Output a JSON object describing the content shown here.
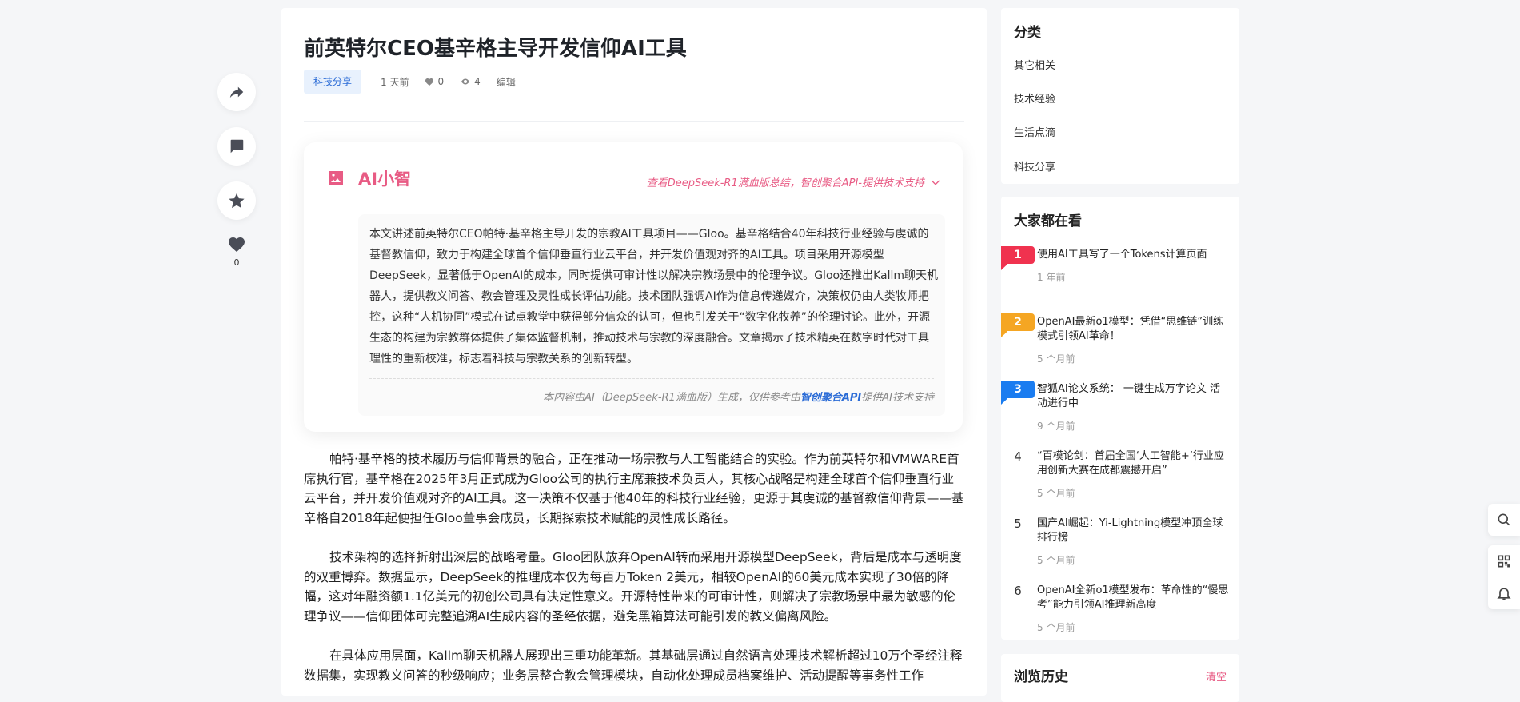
{
  "article": {
    "title": "前英特尔CEO基辛格主导开发信仰AI工具",
    "category_tag": "科技分享",
    "time_ago": "1 天前",
    "likes": "0",
    "views": "4",
    "edit_label": "编辑"
  },
  "actions": {
    "like_count": "0"
  },
  "ai_summary": {
    "name": "AI小智",
    "link_text": "查看DeepSeek-R1满血版总结，智创聚合API-提供技术支持",
    "text": "本文讲述前英特尔CEO帕特·基辛格主导开发的宗教AI工具项目——Gloo。基辛格结合40年科技行业经验与虔诚的基督教信仰，致力于构建全球首个信仰垂直行业云平台，并开发价值观对齐的AI工具。项目采用开源模型DeepSeek，显著低于OpenAI的成本，同时提供可审计性以解决宗教场景中的伦理争议。Gloo还推出Kallm聊天机器人，提供教义问答、教会管理及灵性成长评估功能。技术团队强调AI作为信息传递媒介，决策权仍由人类牧师把控，这种“人机协同”模式在试点教堂中获得部分信众的认可，但也引发关于“数字化牧养”的伦理讨论。此外，开源生态的构建为宗教群体提供了集体监督机制，推动技术与宗教的深度融合。文章揭示了技术精英在数字时代对工具理性的重新校准，标志着科技与宗教关系的创新转型。",
    "footer_prefix": "本内容由AI（DeepSeek-R1满血版）生成，仅供参考由",
    "footer_link": "智创聚合API",
    "footer_suffix": "提供AI技术支持"
  },
  "paragraphs": [
    "帕特·基辛格的技术履历与信仰背景的融合，正在推动一场宗教与人工智能结合的实验。作为前英特尔和VMWARE首席执行官，基辛格在2025年3月正式成为Gloo公司的执行主席兼技术负责人，其核心战略是构建全球首个信仰垂直行业云平台，并开发价值观对齐的AI工具。这一决策不仅基于他40年的科技行业经验，更源于其虔诚的基督教信仰背景——基辛格自2018年起便担任Gloo董事会成员，长期探索技术赋能的灵性成长路径。",
    "技术架构的选择折射出深层的战略考量。Gloo团队放弃OpenAI转而采用开源模型DeepSeek，背后是成本与透明度的双重博弈。数据显示，DeepSeek的推理成本仅为每百万Token 2美元，相较OpenAI的60美元成本实现了30倍的降幅，这对年融资额1.1亿美元的初创公司具有决定性意义。开源特性带来的可审计性，则解决了宗教场景中最为敏感的伦理争议——信仰团体可完整追溯AI生成内容的圣经依据，避免黑箱算法可能引发的教义偏离风险。",
    "在具体应用层面，Kallm聊天机器人展现出三重功能革新。其基础层通过自然语言处理技术解析超过10万个圣经注释数据集，实现教义问答的秒级响应；业务层整合教会管理模块，自动化处理成员档案维护、活动提醒等事务性工作"
  ],
  "sidebar": {
    "categories": {
      "title": "分类",
      "items": [
        "其它相关",
        "技术经验",
        "生活点滴",
        "科技分享"
      ]
    },
    "hot": {
      "title": "大家都在看",
      "items": [
        {
          "rank": "1",
          "title": "使用AI工具写了一个Tokens计算页面",
          "time": "1 年前"
        },
        {
          "rank": "2",
          "title": "OpenAI最新o1模型：凭借“思维链”训练模式引领AI革命！",
          "time": "5 个月前"
        },
        {
          "rank": "3",
          "title": "智狐AI论文系统： 一键生成万字论文 活动进行中",
          "time": "9 个月前"
        },
        {
          "rank": "4",
          "title": "“百模论剑：首届全国‘人工智能+’行业应用创新大赛在成都震撼开启”",
          "time": "5 个月前"
        },
        {
          "rank": "5",
          "title": "国产AI崛起：Yi-Lightning模型冲顶全球排行榜",
          "time": "5 个月前"
        },
        {
          "rank": "6",
          "title": "OpenAI全新o1模型发布：革命性的“慢思考”能力引领AI推理新高度",
          "time": "5 个月前"
        }
      ]
    },
    "history": {
      "title": "浏览历史",
      "clear_label": "清空"
    }
  },
  "colors": {
    "accent": "#e85b84",
    "tag_bg": "#e8f1fd",
    "tag_text": "#2a6bd6",
    "rank1": "#f0324f",
    "rank2": "#f5a623",
    "rank3": "#1a7cf0"
  },
  "icons": [
    "share-icon",
    "comment-icon",
    "star-icon",
    "heart-icon",
    "eye-icon",
    "image-icon",
    "chevron-down-icon",
    "search-icon",
    "qrcode-icon",
    "bell-icon"
  ]
}
